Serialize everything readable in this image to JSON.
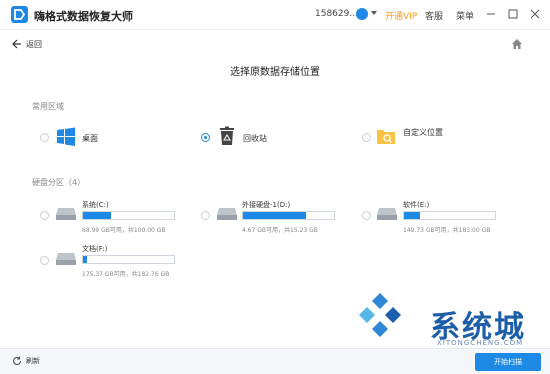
{
  "titlebar": {
    "app_title": "嗨格式数据恢复大师",
    "account": "158629...",
    "vip": "开通VIP",
    "service": "客服",
    "menu": "菜单"
  },
  "nav": {
    "back_label": "返回"
  },
  "page_title": "选择原数据存储位置",
  "common": {
    "section_label": "常用区域",
    "items": [
      {
        "label": "桌面",
        "icon": "windows-icon",
        "selected": false
      },
      {
        "label": "回收站",
        "icon": "recycle-bin-icon",
        "selected": true
      },
      {
        "label": "自定义位置",
        "icon": "folder-search-icon",
        "selected": false
      }
    ]
  },
  "drives": {
    "section_label": "硬盘分区（4）",
    "items": [
      {
        "name": "系统(C:)",
        "info": "68.99 GB可用，共100.00 GB",
        "used_fraction": 0.31
      },
      {
        "name": "外接硬盘-1(D:)",
        "info": "4.67 GB可用，共15.23 GB",
        "used_fraction": 0.69
      },
      {
        "name": "软件(E:)",
        "info": "149.73 GB可用，共183.00 GB",
        "used_fraction": 0.18
      },
      {
        "name": "文档(F:)",
        "info": "175.37 GB可用，共182.76 GB",
        "used_fraction": 0.04
      }
    ]
  },
  "bottom": {
    "refresh_label": "刷新",
    "scan_label": "开始扫描"
  },
  "watermark": {
    "text": "系统城",
    "sub": "XITONGCHENG.COM"
  },
  "colors": {
    "accent": "#1e88e5",
    "vip": "#f39a1e"
  }
}
